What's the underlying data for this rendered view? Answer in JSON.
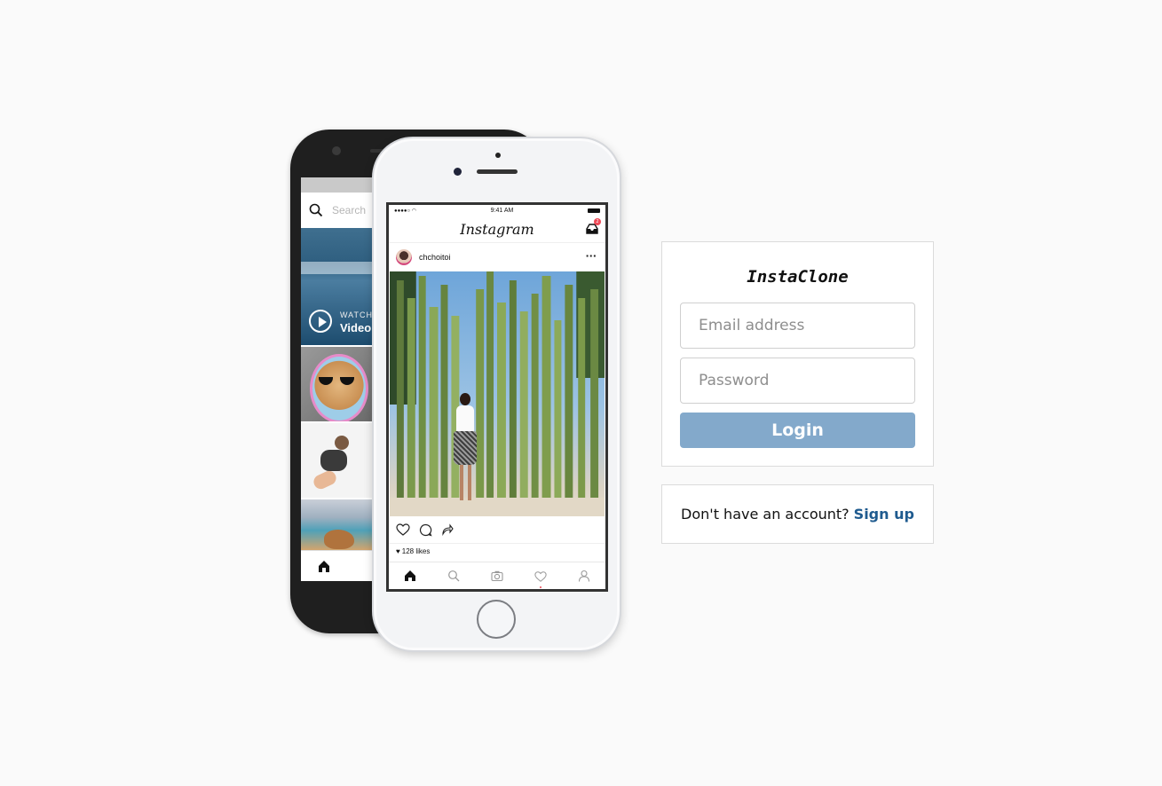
{
  "phones": {
    "back": {
      "search_placeholder": "Search",
      "tile_watch": "WATCH",
      "tile_video": "Video",
      "icons": {
        "search": "search-icon",
        "home": "home-icon",
        "play": "play-icon"
      }
    },
    "front": {
      "status_time": "9:41 AM",
      "app_logo": "Instagram",
      "inbox_badge": "2",
      "post_username": "chchoitoi",
      "post_more": "···",
      "likes": "128 likes",
      "notification_count": "1",
      "icons": {
        "inbox": "inbox-icon",
        "like": "heart-icon",
        "comment": "comment-icon",
        "share": "share-icon",
        "home": "home-icon",
        "search": "search-icon",
        "camera": "camera-icon",
        "activity": "heart-icon",
        "profile": "profile-icon",
        "follower": "person-icon"
      }
    }
  },
  "login": {
    "brand": "InstaClone",
    "email_placeholder": "Email address",
    "password_placeholder": "Password",
    "login_label": "Login"
  },
  "signup": {
    "prompt": "Don't have an account?",
    "link_label": "Sign up"
  },
  "colors": {
    "background": "#fafafa",
    "login_button": "#83a9cb",
    "link": "#1f5b8f",
    "notification": "#ed4956"
  }
}
